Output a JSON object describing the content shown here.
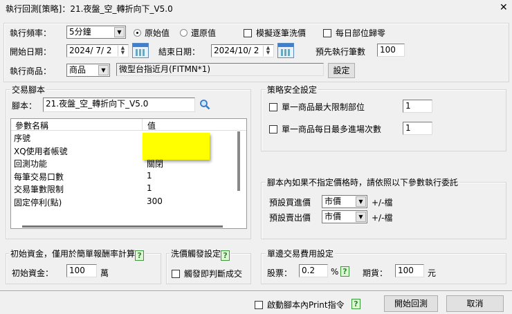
{
  "title": "執行回測[策略]：21.夜盤_空_轉折向下_V5.0",
  "close_glyph": "✕",
  "top": {
    "freq_label": "執行頻率：",
    "freq_value": "5分鐘",
    "radio_original": "原始值",
    "radio_restored": "還原值",
    "cb_tick_sim": "模擬逐筆洗價",
    "cb_daily_zero": "每日部位歸零",
    "start_label": "開始日期：",
    "start_value": "2024/ 7/ 2",
    "end_label": "結束日期：",
    "end_value": "2024/10/ 2",
    "preexec_label": "預先執行筆數",
    "preexec_value": "100",
    "product_label": "執行商品：",
    "product_type": "商品",
    "product_value": "微型台指近月(FITMN*1)",
    "set_button": "設定"
  },
  "script": {
    "group_label": "交易腳本",
    "script_label": "腳本：",
    "script_value": "21.夜盤_空_轉折向下_V5.0",
    "col_name": "參數名稱",
    "col_value": "值",
    "rows": [
      {
        "name": "序號",
        "value": ""
      },
      {
        "name": "XQ使用者帳號",
        "value": ""
      },
      {
        "name": "回測功能",
        "value": "關閉"
      },
      {
        "name": "每筆交易口數",
        "value": "1"
      },
      {
        "name": "交易筆數限制",
        "value": "1"
      },
      {
        "name": "固定停利(點)",
        "value": "300"
      }
    ],
    "redaction_color": "#ffff00"
  },
  "safety": {
    "group_label": "策略安全設定",
    "max_position_label": "單一商品最大限制部位",
    "max_position_value": "1",
    "max_entries_label": "單一商品每日最多進場次數",
    "max_entries_value": "1"
  },
  "price": {
    "group_label": "腳本內如果不指定價格時，請依照以下參數執行委託",
    "buy_label": "預設買進價",
    "buy_value": "市價",
    "buy_unit": "+/-檔",
    "sell_label": "預設賣出價",
    "sell_value": "市價",
    "sell_unit": "+/-檔"
  },
  "capital": {
    "group_label": "初始資金，僅用於簡單報酬率計算",
    "label": "初始資金：",
    "value": "100",
    "unit": "萬"
  },
  "trigger": {
    "group_label": "洗價觸發設定",
    "cb_label": "觸發即判斷成交"
  },
  "fee": {
    "group_label": "單邊交易費用設定",
    "stock_label": "股票：",
    "stock_value": "0.2",
    "stock_unit": "%",
    "futures_label": "期貨：",
    "futures_value": "100",
    "futures_unit": "元"
  },
  "footer": {
    "cb_print": "啟動腳本內Print指令",
    "start_button": "開始回測",
    "cancel_button": "取消"
  },
  "help_glyph": "?"
}
